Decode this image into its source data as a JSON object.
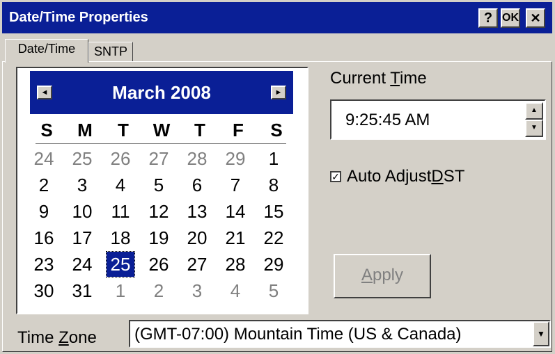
{
  "window": {
    "title": "Date/Time Properties",
    "help_label": "?",
    "ok_label": "OK",
    "close_label": "✕"
  },
  "tabs": [
    {
      "label": "Date/Time",
      "active": true
    },
    {
      "label": "SNTP",
      "active": false
    }
  ],
  "calendar": {
    "month_year": "March 2008",
    "prev_icon": "◄",
    "next_icon": "►",
    "weekdays": [
      "S",
      "M",
      "T",
      "W",
      "T",
      "F",
      "S"
    ],
    "weeks": [
      [
        "24",
        "25",
        "26",
        "27",
        "28",
        "29",
        "1"
      ],
      [
        "2",
        "3",
        "4",
        "5",
        "6",
        "7",
        "8"
      ],
      [
        "9",
        "10",
        "11",
        "12",
        "13",
        "14",
        "15"
      ],
      [
        "16",
        "17",
        "18",
        "19",
        "20",
        "21",
        "22"
      ],
      [
        "23",
        "24",
        "25",
        "26",
        "27",
        "28",
        "29"
      ],
      [
        "30",
        "31",
        "1",
        "2",
        "3",
        "4",
        "5"
      ]
    ],
    "selected_day": "25"
  },
  "current_time": {
    "label_prefix": "Current ",
    "label_key": "T",
    "label_suffix": "ime",
    "value": "9:25:45 AM",
    "up_icon": "▲",
    "down_icon": "▼"
  },
  "auto_dst": {
    "label_prefix": "Auto Adjust ",
    "label_key": "D",
    "label_suffix": "ST",
    "checked": true,
    "check_glyph": "✓"
  },
  "apply": {
    "label_key": "A",
    "label_suffix": "pply"
  },
  "timezone": {
    "label_prefix": "Time ",
    "label_key": "Z",
    "label_suffix": "one",
    "value": "(GMT-07:00) Mountain Time (US & Canada)",
    "drop_icon": "▼"
  }
}
